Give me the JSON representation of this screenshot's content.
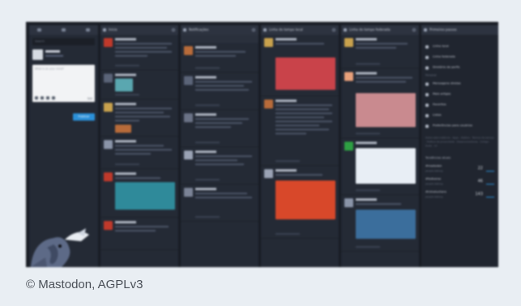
{
  "caption": "© Mastodon, AGPLv3",
  "compose": {
    "search_placeholder": "Search",
    "placeholder": "What is on your mind?",
    "char_count": "500",
    "publish_label": "Publicar"
  },
  "columns": [
    {
      "title": "Início"
    },
    {
      "title": "Notificações"
    },
    {
      "title": "Linha do tempo local"
    },
    {
      "title": "Linha do tempo federada"
    },
    {
      "title": "Primeiros passos"
    }
  ],
  "settings_menu": {
    "items": [
      "Linha local",
      "Linha federada",
      "Diretório de perfis",
      "Mensagens diretas",
      "Mais artigos",
      "Favoritos",
      "Listas",
      "Preferências para usuários"
    ],
    "separator": "Personal",
    "footer": "Sobre esta instância · Apps · Atalhos · Termos de serviço · Política de privacidade · Desenvolvedores · Código-fonte · v3"
  },
  "trends": {
    "heading": "Tendências atuais",
    "items": [
      {
        "tag": "#mastodon",
        "stats": "people talking",
        "count": "22"
      },
      {
        "tag": "#fediverse",
        "stats": "people talking",
        "count": "46"
      },
      {
        "tag": "#introductions",
        "stats": "people talking",
        "count": "143"
      }
    ]
  },
  "colors": {
    "accent": "#2b90d9",
    "background": "#181c24",
    "column": "#242a35"
  }
}
